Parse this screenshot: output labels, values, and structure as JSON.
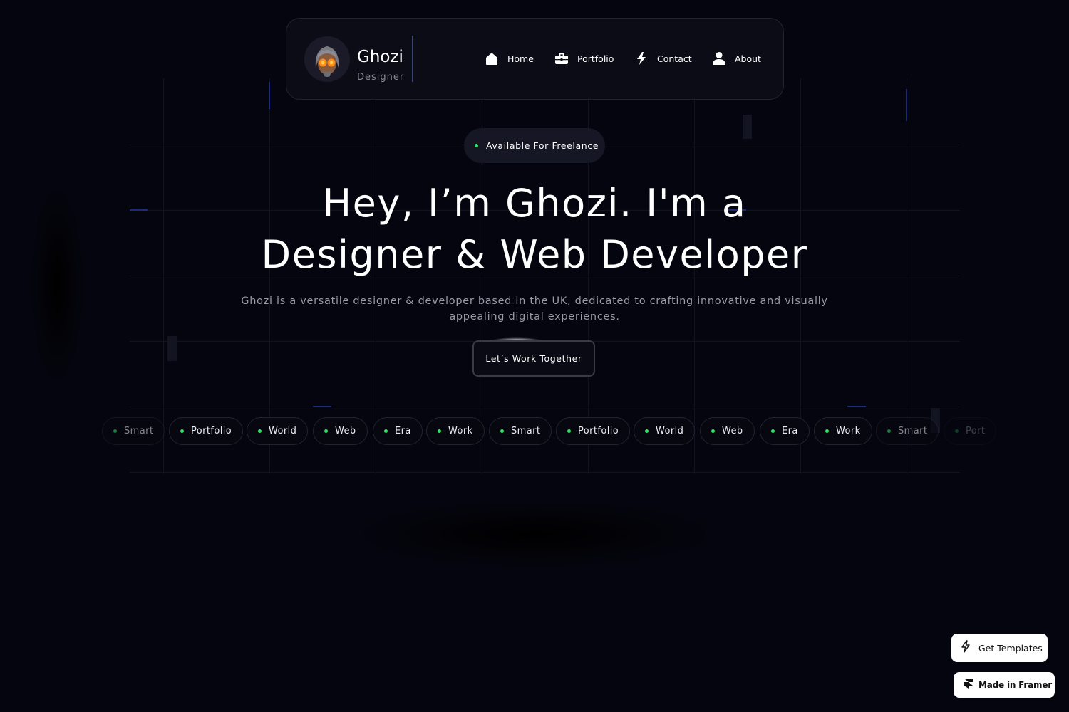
{
  "nav": {
    "brand_name": "Ghozi",
    "brand_role": "Designer",
    "items": [
      {
        "label": "Home",
        "icon": "home-icon"
      },
      {
        "label": "Portfolio",
        "icon": "briefcase-icon"
      },
      {
        "label": "Contact",
        "icon": "lightning-icon"
      },
      {
        "label": "About",
        "icon": "user-icon"
      }
    ]
  },
  "hero": {
    "badge": "Available For Freelance",
    "title_line1": "Hey, I’m Ghozi. I'm a",
    "title_line2": "Designer & Web Developer",
    "description": "Ghozi is a versatile designer & developer based in the UK, dedicated to crafting innovative and visually appealing digital experiences.",
    "cta": "Let’s Work Together"
  },
  "tags": [
    "Smart",
    "Portfolio",
    "World",
    "Web",
    "Era",
    "Work",
    "Smart",
    "Portfolio",
    "World",
    "Web",
    "Era",
    "Work",
    "Smart",
    "Port"
  ],
  "floating": {
    "get_templates": "Get Templates",
    "made_in_framer": "Made in Framer"
  },
  "colors": {
    "background": "#05050f",
    "accent_dot": "#32e36a",
    "accent_line": "#1c2a78",
    "text_muted": "#9a9aa8"
  }
}
